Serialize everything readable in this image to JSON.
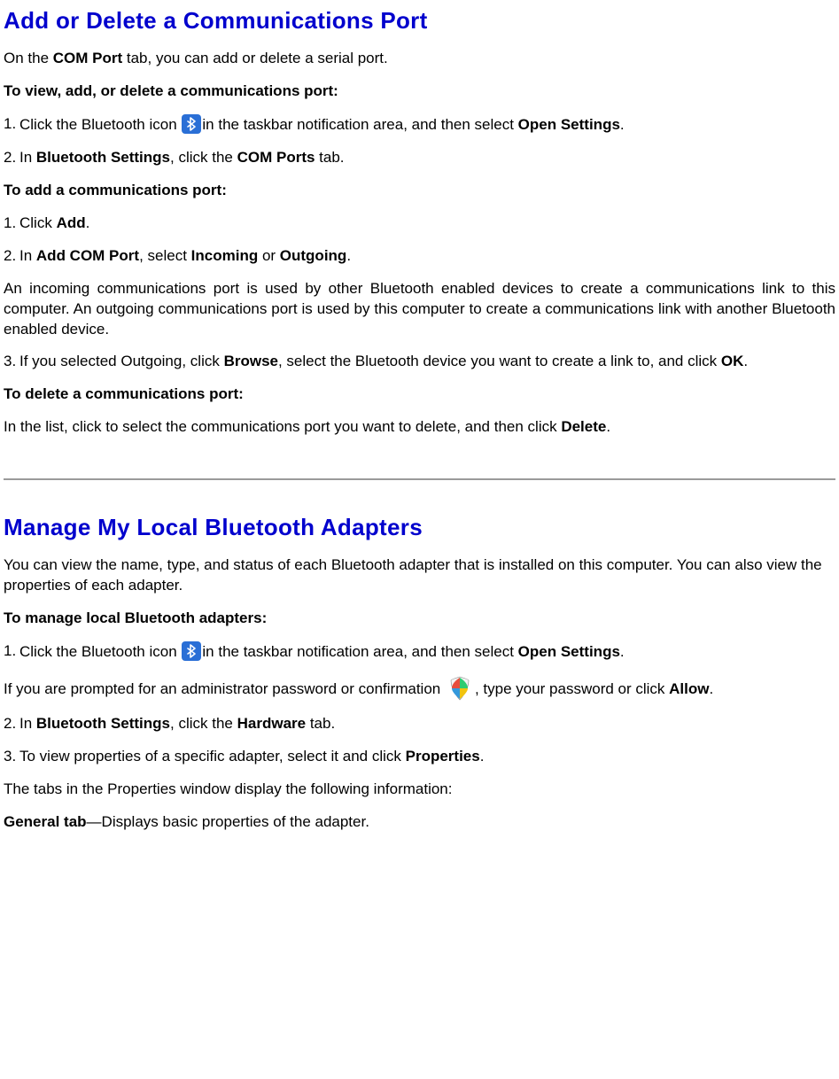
{
  "section1": {
    "heading": "Add or Delete a Communications Port",
    "intro_pre": "On the ",
    "intro_bold": "COM Port",
    "intro_post": " tab, you can add or delete a serial port.",
    "subhead1": "To view, add, or delete a communications port:",
    "step1_num": "1.",
    "step1_pre": "Click the Bluetooth icon ",
    "step1_mid": "in the taskbar notification area, and then select ",
    "step1_bold": "Open Settings",
    "step1_post": ".",
    "step2_num": "2.",
    "step2_pre": "In ",
    "step2_b1": "Bluetooth Settings",
    "step2_mid": ", click the ",
    "step2_b2": "COM Ports",
    "step2_post": " tab.",
    "subhead2": "To add a communications port:",
    "add1_num": "1.",
    "add1_pre": "Click ",
    "add1_b": "Add",
    "add1_post": ".",
    "add2_num": "2.",
    "add2_pre": "In ",
    "add2_b1": "Add COM Port",
    "add2_mid": ", select ",
    "add2_b2": "Incoming",
    "add2_or": " or ",
    "add2_b3": "Outgoing",
    "add2_post": ".",
    "explain": "An incoming communications port is used by other Bluetooth enabled devices to create a communications link to this computer. An outgoing communications port is used by this computer to create a communications link with another Bluetooth enabled device.",
    "add3_num": "3.",
    "add3_pre": "If you selected Outgoing, click ",
    "add3_b1": "Browse",
    "add3_mid": ", select the Bluetooth device you want to create a link to, and click ",
    "add3_b2": "OK",
    "add3_post": ".",
    "subhead3": "To delete a communications port:",
    "delete_pre": "In the list, click to select the communications port you want to delete, and then click ",
    "delete_b": "Delete",
    "delete_post": "."
  },
  "section2": {
    "heading": "Manage My Local Bluetooth Adapters",
    "intro": "You can view the name, type, and status of each Bluetooth adapter that is installed on this computer. You can also view the properties of each adapter.",
    "subhead": "To manage local Bluetooth adapters:",
    "step1_num": "1.",
    "step1_pre": "Click the Bluetooth icon ",
    "step1_mid": "in the taskbar notification area, and then select ",
    "step1_bold": "Open Settings",
    "step1_post": ".",
    "prompt_pre": "If you are prompted for an administrator password or confirmation ",
    "prompt_mid": ", type your password or click ",
    "prompt_b": "Allow",
    "prompt_post": ".",
    "step2_num": "2.",
    "step2_pre": "In ",
    "step2_b1": "Bluetooth Settings",
    "step2_mid": ", click the ",
    "step2_b2": "Hardware",
    "step2_post": " tab.",
    "step3_num": "3.",
    "step3_pre": "To view properties of a specific adapter, select it and click ",
    "step3_b": "Properties",
    "step3_post": ".",
    "tabs_intro": "The tabs in the Properties window display the following information:",
    "general_b": "General tab",
    "general_post": "—Displays basic properties of the adapter."
  }
}
